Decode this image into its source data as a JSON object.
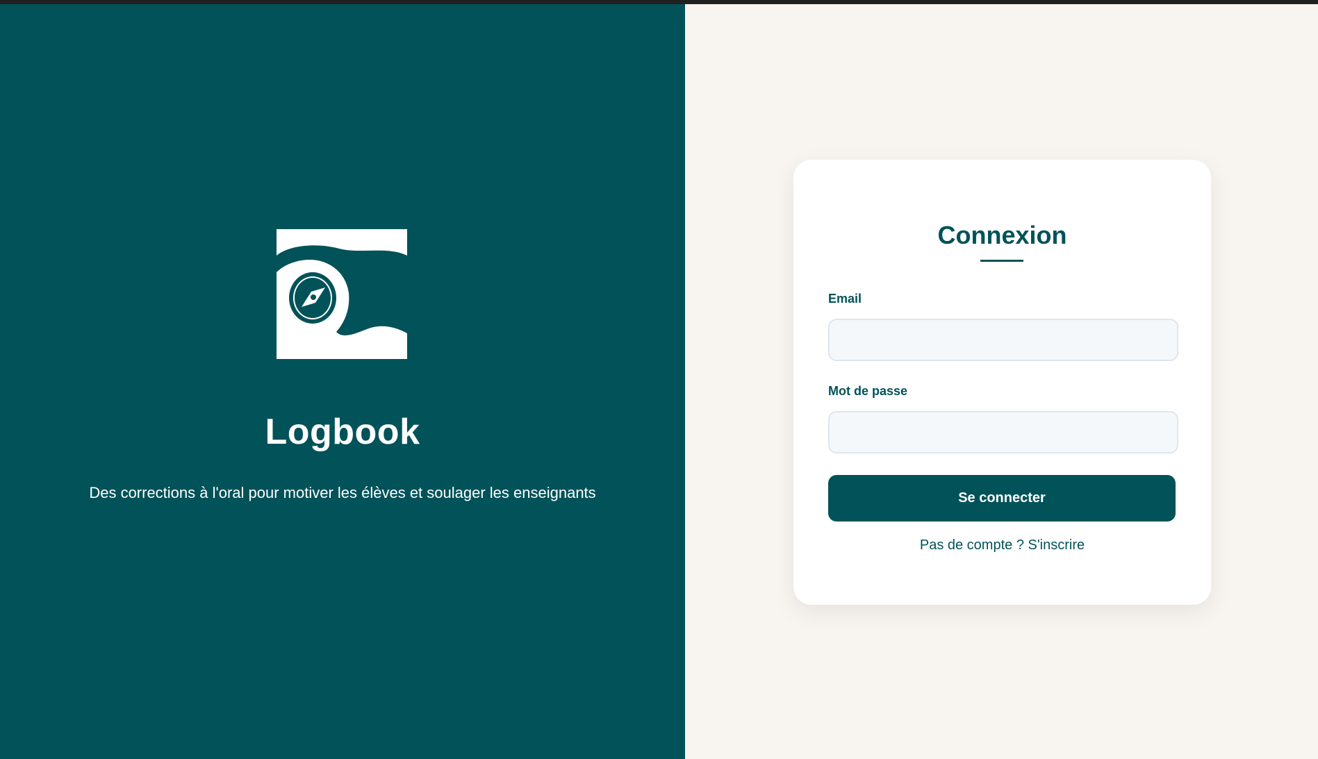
{
  "colors": {
    "brand": "#025259",
    "page_background": "#f8f5f0",
    "card_background": "#ffffff",
    "input_background": "#f5f8fb"
  },
  "branding": {
    "logo_icon": "compass-logo-icon",
    "name": "Logbook",
    "tagline": "Des corrections à l'oral pour motiver les élèves et soulager les enseignants"
  },
  "login": {
    "title": "Connexion",
    "email_label": "Email",
    "email_value": "",
    "password_label": "Mot de passe",
    "password_value": "",
    "submit_label": "Se connecter",
    "signup_text": "Pas de compte ? S'inscrire"
  }
}
